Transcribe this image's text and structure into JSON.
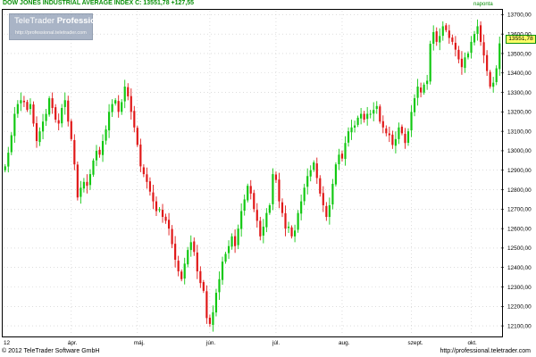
{
  "header": {
    "title": "DOW JONES INDUSTRIAL AVERAGE INDEX",
    "close_label": "C: 13551,78",
    "change": "+127,55",
    "period": "naponta"
  },
  "logo": {
    "brand": "TeleTrader",
    "brand_bold": "Professional",
    "url": "http://professional.teletrader.com"
  },
  "footer": {
    "copyright": "© 2012 TeleTrader Software GmbH",
    "url": "http://professional.teletrader.com"
  },
  "colors": {
    "up": "#12c812",
    "down": "#e01818",
    "text": "#0a8f0a",
    "price_box": "#ffff66"
  },
  "chart_data": {
    "type": "candlestick",
    "title": "DOW JONES INDUSTRIAL AVERAGE INDEX",
    "last_price": "13551,78",
    "ylim": [
      12050,
      13720
    ],
    "y_ticks": [
      "12100,00",
      "12200,00",
      "12300,00",
      "12400,00",
      "12500,00",
      "12600,00",
      "12700,00",
      "12800,00",
      "12900,00",
      "13000,00",
      "13100,00",
      "13200,00",
      "13300,00",
      "13400,00",
      "13500,00",
      "13600,00",
      "13700,00"
    ],
    "x_ticks": [
      {
        "label": "12",
        "index": 0
      },
      {
        "label": "ápr.",
        "index": 21
      },
      {
        "label": "máj.",
        "index": 42
      },
      {
        "label": "jún.",
        "index": 65
      },
      {
        "label": "júl.",
        "index": 86
      },
      {
        "label": "aug.",
        "index": 107
      },
      {
        "label": "szept.",
        "index": 129
      },
      {
        "label": "okt.",
        "index": 148
      }
    ],
    "closes": [
      12920,
      12990,
      13080,
      13190,
      13240,
      13260,
      13250,
      13210,
      13240,
      13140,
      13050,
      13100,
      13150,
      13190,
      13270,
      13220,
      13160,
      13140,
      13220,
      13260,
      13150,
      13060,
      12930,
      12760,
      12810,
      12840,
      12820,
      12880,
      12950,
      13000,
      12980,
      13050,
      13110,
      13200,
      13240,
      13260,
      13200,
      13250,
      13330,
      13280,
      13200,
      13120,
      13030,
      12920,
      12880,
      12840,
      12790,
      12740,
      12690,
      12700,
      12660,
      12640,
      12600,
      12520,
      12440,
      12380,
      12340,
      12420,
      12490,
      12530,
      12480,
      12380,
      12320,
      12280,
      12140,
      12110,
      12170,
      12270,
      12340,
      12430,
      12470,
      12510,
      12560,
      12510,
      12600,
      12690,
      12750,
      12820,
      12780,
      12700,
      12640,
      12560,
      12610,
      12680,
      12720,
      12880,
      12850,
      12740,
      12680,
      12600,
      12610,
      12560,
      12590,
      12680,
      12740,
      12810,
      12870,
      12900,
      12940,
      12860,
      12780,
      12720,
      12660,
      12720,
      12830,
      12930,
      12980,
      12960,
      13040,
      13100,
      13120,
      13130,
      13170,
      13190,
      13160,
      13190,
      13190,
      13210,
      13230,
      13150,
      13120,
      13090,
      13080,
      13030,
      13060,
      13120,
      13090,
      13040,
      13100,
      13200,
      13270,
      13330,
      13300,
      13340,
      13360,
      13550,
      13610,
      13560,
      13590,
      13640,
      13620,
      13580,
      13560,
      13520,
      13470,
      13430,
      13480,
      13500,
      13560,
      13600,
      13640,
      13560,
      13490,
      13410,
      13330,
      13350,
      13424,
      13552
    ]
  }
}
